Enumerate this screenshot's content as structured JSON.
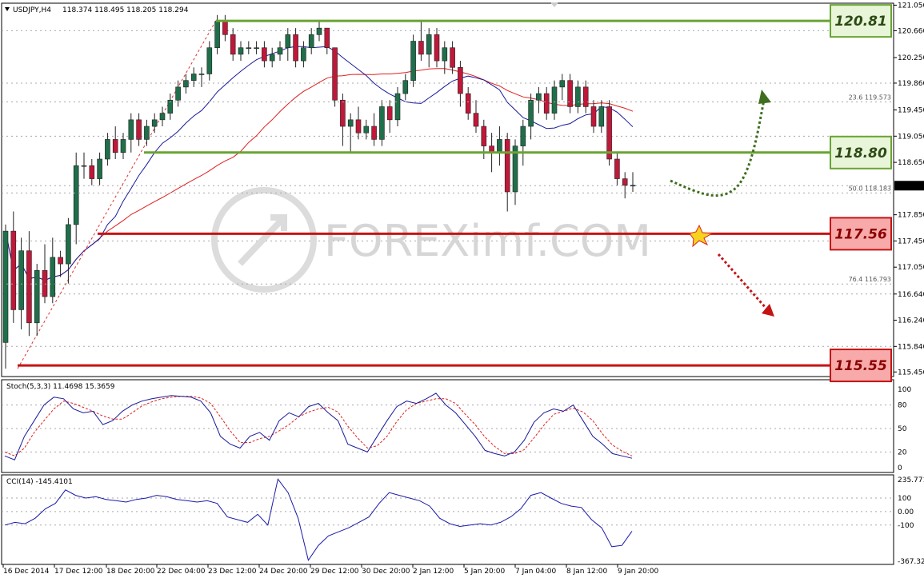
{
  "header": {
    "symbol": "USDJPY,H4",
    "ohlc": "118.374 118.495 118.205 118.294",
    "stoch_label": "Stoch(5,3,3) 11.4698 15.3659",
    "cci_label": "CCI(14) -145.4101"
  },
  "watermark": "FOREXimf.COM",
  "price_ticks": [
    "121.050",
    "120.660",
    "120.250",
    "119.860",
    "119.450",
    "119.050",
    "118.650",
    "118.294",
    "117.850",
    "117.450",
    "117.050",
    "116.640",
    "116.240",
    "115.840",
    "115.450"
  ],
  "stoch_ticks": [
    "100",
    "80",
    "50",
    "20",
    "0"
  ],
  "cci_ticks": [
    "235.771",
    "100",
    "0.00",
    "-100",
    "-367.321"
  ],
  "time_labels": [
    "16 Dec 2014",
    "17 Dec 12:00",
    "18 Dec 20:00",
    "22 Dec 04:00",
    "23 Dec 12:00",
    "24 Dec 20:00",
    "29 Dec 12:00",
    "30 Dec 20:00",
    "2 Jan 12:00",
    "5 Jan 20:00",
    "7 Jan 04:00",
    "8 Jan 12:00",
    "9 Jan 20:00"
  ],
  "levels": [
    {
      "price": "120.81",
      "value": 120.81,
      "kind": "resistance",
      "color": "#6aa334",
      "bg": "#e8f5d8"
    },
    {
      "price": "118.80",
      "value": 118.8,
      "kind": "resistance",
      "color": "#6aa334",
      "bg": "#e8f5d8"
    },
    {
      "price": "117.56",
      "value": 117.56,
      "kind": "support",
      "color": "#c41414",
      "bg": "#f8aaaa"
    },
    {
      "price": "115.55",
      "value": 115.55,
      "kind": "support",
      "color": "#c41414",
      "bg": "#f8aaaa"
    }
  ],
  "fib_labels": [
    {
      "text": "23.6 119.573",
      "value": 119.573
    },
    {
      "text": "50.0 118.183",
      "value": 118.183
    },
    {
      "text": "76.4 116.793",
      "value": 116.793
    }
  ],
  "chart_data": {
    "type": "candlestick",
    "symbol": "USDJPY",
    "timeframe": "H4",
    "ylim": [
      115.38,
      121.08
    ],
    "candles": [
      [
        115.9,
        117.7,
        115.5,
        117.6
      ],
      [
        117.6,
        117.9,
        116.2,
        116.4
      ],
      [
        116.4,
        117.5,
        116.1,
        117.3
      ],
      [
        117.3,
        117.6,
        116.0,
        116.2
      ],
      [
        116.2,
        117.1,
        116.0,
        117.0
      ],
      [
        117.0,
        117.4,
        116.5,
        116.6
      ],
      [
        116.6,
        117.5,
        116.5,
        117.2
      ],
      [
        117.2,
        117.3,
        116.9,
        117.1
      ],
      [
        117.1,
        117.8,
        116.8,
        117.7
      ],
      [
        117.7,
        118.8,
        117.4,
        118.6
      ],
      [
        118.6,
        118.8,
        118.4,
        118.6
      ],
      [
        118.6,
        118.7,
        118.3,
        118.4
      ],
      [
        118.4,
        118.8,
        118.3,
        118.7
      ],
      [
        118.7,
        119.1,
        118.6,
        119.0
      ],
      [
        119.0,
        119.2,
        118.7,
        118.8
      ],
      [
        118.8,
        119.1,
        118.7,
        119.0
      ],
      [
        119.0,
        119.4,
        118.8,
        119.3
      ],
      [
        119.3,
        119.4,
        118.9,
        119.0
      ],
      [
        119.0,
        119.3,
        118.9,
        119.2
      ],
      [
        119.2,
        119.4,
        119.1,
        119.3
      ],
      [
        119.3,
        119.5,
        119.2,
        119.4
      ],
      [
        119.4,
        119.7,
        119.3,
        119.6
      ],
      [
        119.6,
        119.9,
        119.5,
        119.8
      ],
      [
        119.8,
        120.0,
        119.7,
        119.9
      ],
      [
        119.9,
        120.1,
        119.8,
        120.0
      ],
      [
        120.0,
        120.1,
        119.8,
        120.0
      ],
      [
        120.0,
        120.5,
        119.9,
        120.4
      ],
      [
        120.4,
        120.9,
        120.3,
        120.8
      ],
      [
        120.8,
        120.9,
        120.5,
        120.6
      ],
      [
        120.6,
        120.7,
        120.2,
        120.3
      ],
      [
        120.3,
        120.5,
        120.2,
        120.4
      ],
      [
        120.4,
        120.5,
        120.3,
        120.4
      ],
      [
        120.4,
        120.5,
        120.3,
        120.4
      ],
      [
        120.4,
        120.5,
        120.1,
        120.2
      ],
      [
        120.2,
        120.4,
        120.1,
        120.3
      ],
      [
        120.3,
        120.5,
        120.2,
        120.4
      ],
      [
        120.4,
        120.7,
        120.2,
        120.6
      ],
      [
        120.6,
        120.7,
        120.1,
        120.2
      ],
      [
        120.2,
        120.5,
        120.1,
        120.4
      ],
      [
        120.4,
        120.7,
        120.3,
        120.6
      ],
      [
        120.6,
        120.8,
        120.5,
        120.7
      ],
      [
        120.7,
        120.7,
        120.3,
        120.4
      ],
      [
        120.4,
        120.4,
        119.5,
        119.6
      ],
      [
        119.6,
        119.7,
        118.9,
        119.2
      ],
      [
        119.2,
        119.4,
        118.8,
        119.3
      ],
      [
        119.3,
        119.5,
        119.0,
        119.1
      ],
      [
        119.1,
        119.3,
        119.0,
        119.2
      ],
      [
        119.2,
        119.4,
        118.9,
        119.0
      ],
      [
        119.0,
        119.6,
        118.9,
        119.5
      ],
      [
        119.5,
        119.6,
        119.1,
        119.3
      ],
      [
        119.3,
        119.8,
        119.2,
        119.7
      ],
      [
        119.7,
        120.0,
        119.6,
        119.9
      ],
      [
        119.9,
        120.6,
        119.8,
        120.5
      ],
      [
        120.5,
        120.8,
        120.2,
        120.3
      ],
      [
        120.3,
        120.7,
        120.1,
        120.6
      ],
      [
        120.6,
        120.7,
        120.1,
        120.2
      ],
      [
        120.2,
        120.5,
        120.0,
        120.4
      ],
      [
        120.4,
        120.5,
        120.0,
        120.1
      ],
      [
        120.1,
        120.2,
        119.5,
        119.7
      ],
      [
        119.7,
        119.8,
        119.3,
        119.4
      ],
      [
        119.4,
        119.6,
        119.1,
        119.2
      ],
      [
        119.2,
        119.3,
        118.7,
        118.9
      ],
      [
        118.9,
        119.1,
        118.5,
        118.8
      ],
      [
        118.8,
        119.2,
        118.6,
        119.0
      ],
      [
        119.0,
        119.1,
        117.9,
        118.2
      ],
      [
        118.2,
        119.0,
        118.0,
        118.9
      ],
      [
        118.9,
        119.3,
        118.6,
        119.2
      ],
      [
        119.2,
        119.7,
        119.0,
        119.6
      ],
      [
        119.6,
        119.8,
        119.4,
        119.7
      ],
      [
        119.7,
        119.8,
        119.3,
        119.4
      ],
      [
        119.4,
        119.9,
        119.3,
        119.8
      ],
      [
        119.8,
        120.0,
        119.6,
        119.9
      ],
      [
        119.9,
        120.0,
        119.4,
        119.5
      ],
      [
        119.5,
        119.9,
        119.4,
        119.8
      ],
      [
        119.8,
        119.9,
        119.4,
        119.5
      ],
      [
        119.5,
        119.6,
        119.1,
        119.2
      ],
      [
        119.2,
        119.6,
        119.1,
        119.5
      ],
      [
        119.5,
        119.6,
        118.6,
        118.7
      ],
      [
        118.7,
        118.8,
        118.3,
        118.4
      ],
      [
        118.4,
        118.5,
        118.1,
        118.3
      ],
      [
        118.3,
        118.5,
        118.2,
        118.3
      ]
    ],
    "stochastic": {
      "k": [
        15,
        10,
        40,
        60,
        80,
        90,
        88,
        75,
        70,
        72,
        55,
        60,
        72,
        80,
        85,
        88,
        90,
        92,
        91,
        90,
        85,
        70,
        40,
        30,
        25,
        40,
        45,
        35,
        60,
        70,
        65,
        78,
        82,
        70,
        60,
        30,
        25,
        20,
        40,
        60,
        78,
        85,
        82,
        88,
        95,
        80,
        70,
        55,
        40,
        22,
        18,
        15,
        20,
        35,
        58,
        70,
        75,
        72,
        80,
        60,
        40,
        30,
        18,
        15,
        12
      ],
      "d": [
        20,
        15,
        25,
        45,
        60,
        75,
        85,
        82,
        77,
        72,
        66,
        62,
        62,
        70,
        79,
        84,
        88,
        90,
        91,
        91,
        89,
        82,
        65,
        47,
        32,
        32,
        37,
        40,
        47,
        55,
        65,
        71,
        75,
        77,
        71,
        53,
        38,
        25,
        28,
        40,
        59,
        74,
        82,
        85,
        88,
        88,
        82,
        68,
        55,
        39,
        27,
        18,
        18,
        23,
        38,
        54,
        68,
        72,
        76,
        71,
        60,
        43,
        29,
        21,
        15
      ]
    },
    "cci": [
      -100,
      -80,
      -90,
      -50,
      20,
      60,
      160,
      120,
      100,
      110,
      90,
      80,
      70,
      90,
      100,
      120,
      110,
      90,
      80,
      70,
      80,
      60,
      -40,
      -60,
      -80,
      -20,
      -100,
      240,
      140,
      -50,
      -360,
      -250,
      -180,
      -150,
      -120,
      -80,
      -40,
      60,
      140,
      120,
      100,
      80,
      40,
      -50,
      -90,
      -110,
      -100,
      -90,
      -100,
      -80,
      -40,
      20,
      120,
      140,
      100,
      60,
      40,
      30,
      -60,
      -120,
      -260,
      -250,
      -145
    ]
  }
}
